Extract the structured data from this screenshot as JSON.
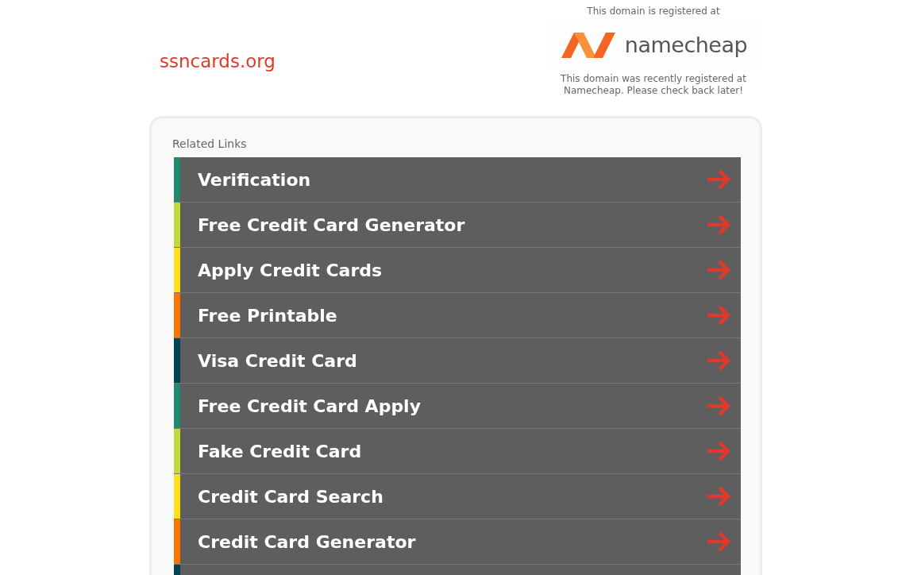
{
  "domain": "ssncards.org",
  "registrar": {
    "caption": "This domain is registered at",
    "logo_text": "namecheap",
    "note": "This domain was recently registered at Namecheap. Please check back later!"
  },
  "related_links": {
    "heading": "Related Links",
    "items": [
      {
        "label": "Verification",
        "color": "#1f8a70"
      },
      {
        "label": "Free Credit Card Generator",
        "color": "#bedb39"
      },
      {
        "label": "Apply Credit Cards",
        "color": "#ffe11a"
      },
      {
        "label": "Free Printable",
        "color": "#fd7400"
      },
      {
        "label": "Visa Credit Card",
        "color": "#004358"
      },
      {
        "label": "Free Credit Card Apply",
        "color": "#1f8a70"
      },
      {
        "label": "Fake Credit Card",
        "color": "#bedb39"
      },
      {
        "label": "Credit Card Search",
        "color": "#ffe11a"
      },
      {
        "label": "Credit Card Generator",
        "color": "#fd7400"
      },
      {
        "color": "#004358"
      }
    ]
  }
}
